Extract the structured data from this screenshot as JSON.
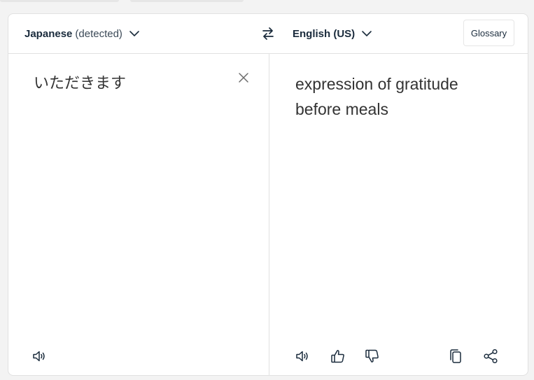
{
  "header": {
    "source_language": "Japanese",
    "source_detected": "(detected)",
    "target_language": "English (US)",
    "glossary_label": "Glossary"
  },
  "source": {
    "text": "いただきます"
  },
  "target": {
    "line1": "expression of gratitude",
    "line2": "before meals"
  },
  "icons": {
    "source_speaker": "speaker-icon",
    "target_speaker": "speaker-icon",
    "thumbs_up": "thumbs-up-icon",
    "thumbs_down": "thumbs-down-icon",
    "copy": "copy-icon",
    "share": "share-icon",
    "swap": "swap-icon",
    "clear": "close-icon"
  },
  "colors": {
    "text_dark": "#1a2b3c",
    "border": "#e1e1e1",
    "background": "#f3f3f3"
  }
}
